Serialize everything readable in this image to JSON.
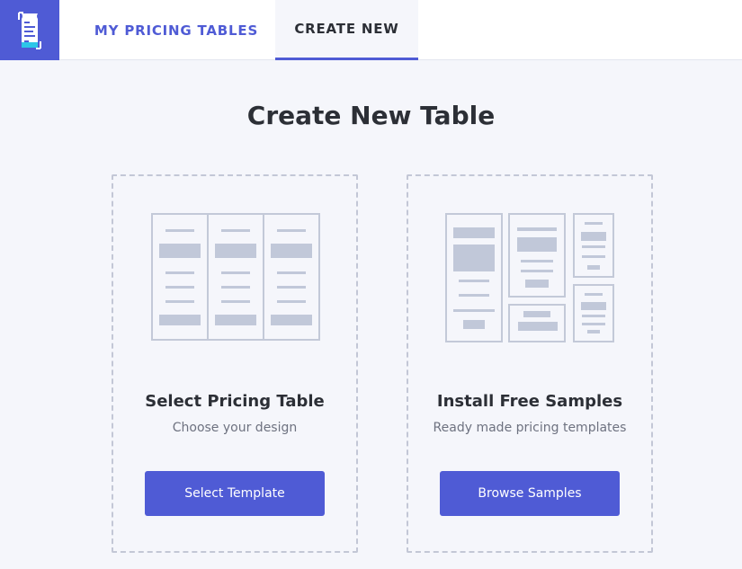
{
  "header": {
    "logo_icon": "pricing-table-logo-icon",
    "tabs": [
      {
        "label": "MY PRICING TABLES",
        "active": false
      },
      {
        "label": "CREATE NEW",
        "active": true
      }
    ]
  },
  "main": {
    "title": "Create New Table",
    "cards": [
      {
        "title": "Select Pricing Table",
        "subtitle": "Choose your design",
        "button_label": "Select Template",
        "illustration_icon": "three-column-table-icon"
      },
      {
        "title": "Install Free Samples",
        "subtitle": "Ready made pricing templates",
        "button_label": "Browse Samples",
        "illustration_icon": "sample-layouts-icon"
      }
    ]
  },
  "colors": {
    "accent": "#4f5bd5",
    "background": "#f5f6fb",
    "illustration_stroke": "#c3c9d8",
    "illustration_fill": "#c1c8d9"
  }
}
